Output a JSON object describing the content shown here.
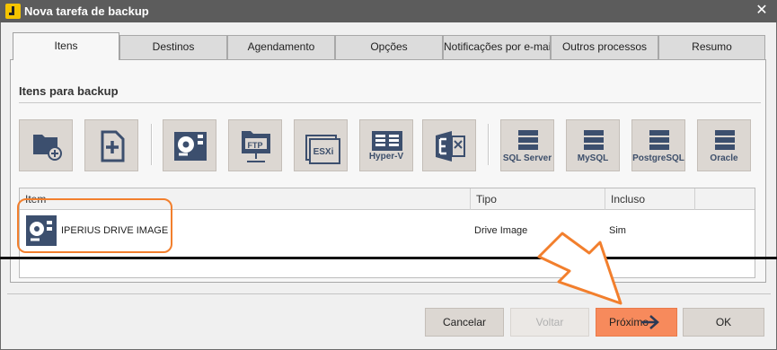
{
  "window": {
    "title": "Nova tarefa de backup",
    "close_glyph": "✕"
  },
  "tabs": [
    {
      "label": "Itens",
      "active": true
    },
    {
      "label": "Destinos"
    },
    {
      "label": "Agendamento"
    },
    {
      "label": "Opções"
    },
    {
      "label": "Notificações por e-mail"
    },
    {
      "label": "Outros processos"
    },
    {
      "label": "Resumo"
    }
  ],
  "section": {
    "title": "Itens para backup"
  },
  "toolbar": [
    {
      "icon": "add-folder-icon",
      "label": ""
    },
    {
      "icon": "add-file-icon",
      "label": ""
    },
    {
      "icon": "drive-image-icon",
      "label": ""
    },
    {
      "icon": "ftp-icon",
      "label": "FTP"
    },
    {
      "icon": "esxi-icon",
      "label": "ESXi"
    },
    {
      "icon": "hyper-v-icon",
      "label": "Hyper-V"
    },
    {
      "icon": "exchange-icon",
      "label": ""
    },
    {
      "icon": "database-icon",
      "label": "SQL Server"
    },
    {
      "icon": "database-icon",
      "label": "MySQL"
    },
    {
      "icon": "database-icon",
      "label": "PostgreSQL"
    },
    {
      "icon": "database-icon",
      "label": "Oracle"
    }
  ],
  "grid": {
    "columns": [
      "Item",
      "Tipo",
      "Incluso"
    ],
    "rows": [
      {
        "item": "IPERIUS DRIVE IMAGE",
        "tipo": "Drive Image",
        "incluso": "Sim",
        "icon": "drive-image-icon"
      }
    ]
  },
  "buttons": {
    "cancel": "Cancelar",
    "back": "Voltar",
    "next": "Próximo",
    "ok": "OK"
  },
  "colors": {
    "titlebar": "#5c5c5c",
    "icon_blue": "#3c4f6e",
    "accent_orange": "#f27f2d",
    "next_button": "#f78a5c"
  }
}
